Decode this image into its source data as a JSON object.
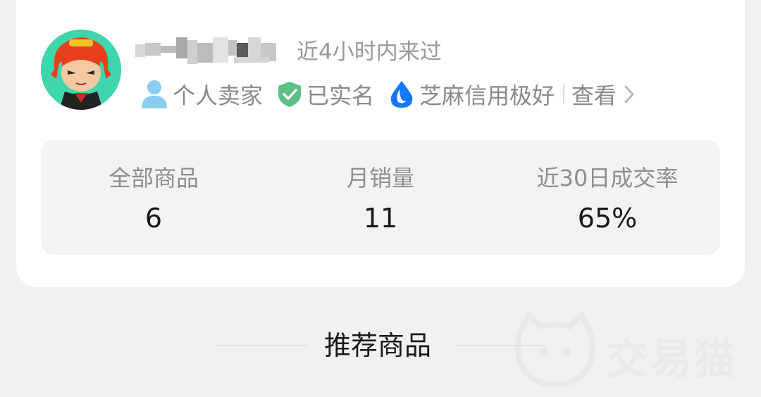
{
  "seller": {
    "last_seen": "近4小时内来过",
    "badges": [
      {
        "icon": "person-icon",
        "label": "个人卖家"
      },
      {
        "icon": "shield-check-icon",
        "label": "已实名"
      },
      {
        "icon": "sesame-credit-icon",
        "label": "芝麻信用极好"
      }
    ],
    "view_label": "查看"
  },
  "stats": [
    {
      "label": "全部商品",
      "value": "6"
    },
    {
      "label": "月销量",
      "value": "11"
    },
    {
      "label": "近30日成交率",
      "value": "65%"
    }
  ],
  "recommend": {
    "title": "推荐商品"
  },
  "watermark": {
    "brand": "交易猫"
  },
  "colors": {
    "person_icon": "#8ccbf2",
    "shield_icon": "#5cbf86",
    "sesame_icon": "#1677ff",
    "stat_bg": "#f3f3f3"
  }
}
